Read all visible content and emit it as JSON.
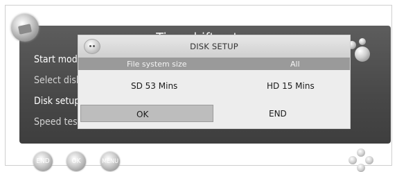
{
  "screen": {
    "title": "Timeshift setup"
  },
  "menu": {
    "items": [
      {
        "label": "Start mode"
      },
      {
        "label": "Select disk"
      },
      {
        "label": "Disk setup"
      },
      {
        "label": "Speed test"
      }
    ]
  },
  "dialog": {
    "title": "DISK SETUP",
    "fs_label": "File system size",
    "fs_value": "All",
    "sd_info": "SD 53 Mins",
    "hd_info": "HD 15 Mins",
    "ok_label": "OK",
    "end_label": "END"
  },
  "footer": {
    "end_label": "END",
    "ok_label": "OK",
    "menu_label": "MENU"
  },
  "icons": {
    "top_left": "setup-icon",
    "top_right": "bubbles-icon",
    "dialog": "disk-face-icon",
    "nav": "navigation-pad-icon"
  },
  "colors": {
    "screen_bg": "#4e4e4e",
    "dialog_header": "#dcdcdc",
    "dialog_body": "#ededed",
    "highlight_row": "#9a9a9a",
    "selected_button": "#bdbdbd"
  }
}
